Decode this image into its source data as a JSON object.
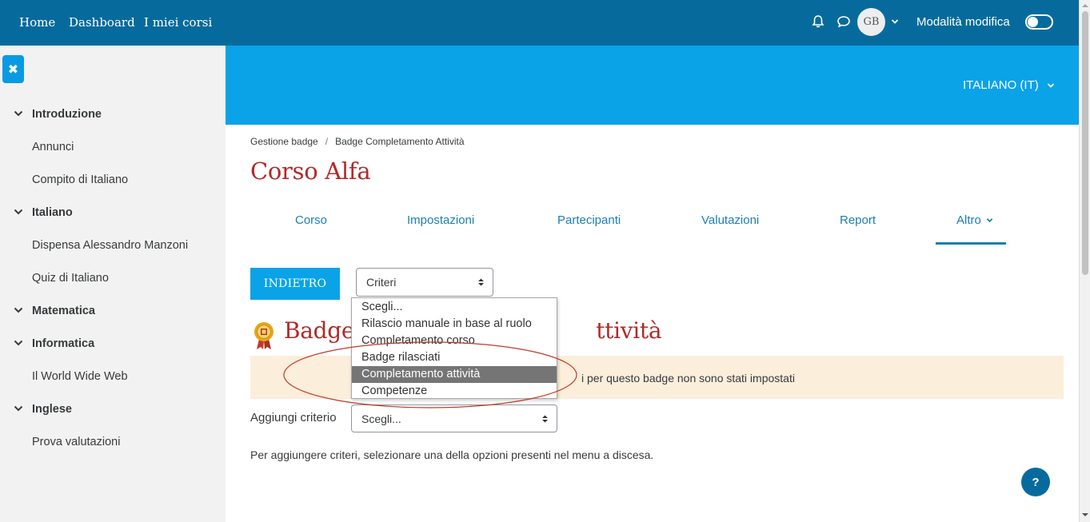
{
  "navbar": {
    "links": [
      "Home",
      "Dashboard",
      "I miei corsi"
    ],
    "avatar_initials": "GB",
    "edit_mode_label": "Modalità modifica",
    "icons": [
      "bell-icon",
      "chat-icon",
      "chevron-down-icon",
      "toggle-switch"
    ]
  },
  "drawer": {
    "close_icon": "close-icon",
    "items": [
      {
        "label": "Introduzione",
        "type": "section"
      },
      {
        "label": "Annunci",
        "type": "child"
      },
      {
        "label": "Compito di Italiano",
        "type": "child"
      },
      {
        "label": "Italiano",
        "type": "section"
      },
      {
        "label": "Dispensa Alessandro Manzoni",
        "type": "child"
      },
      {
        "label": "Quiz di Italiano",
        "type": "child"
      },
      {
        "label": "Matematica",
        "type": "section"
      },
      {
        "label": "Informatica",
        "type": "section"
      },
      {
        "label": "Il World Wide Web",
        "type": "child"
      },
      {
        "label": "Inglese",
        "type": "section"
      },
      {
        "label": "Prova valutazioni",
        "type": "child"
      }
    ]
  },
  "header": {
    "language": "ITALIANO (IT)"
  },
  "breadcrumb": [
    "Gestione badge",
    "Badge Completamento Attività"
  ],
  "course_title": "Corso Alfa",
  "tabs": [
    {
      "label": "Corso"
    },
    {
      "label": "Impostazioni"
    },
    {
      "label": "Partecipanti"
    },
    {
      "label": "Valutazioni"
    },
    {
      "label": "Report"
    },
    {
      "label": "Altro",
      "active": true
    }
  ],
  "toolbar": {
    "back_label": "INDIETRO",
    "criteria_select": "Criteri"
  },
  "badge": {
    "heading_left": "Badge",
    "heading_right": "ttività",
    "alert_text": "i per questo badge non sono stati impostati"
  },
  "add_criterion": {
    "label": "Aggiungi criterio",
    "value": "Scegli...",
    "options": [
      "Scegli...",
      "Rilascio manuale in base al ruolo",
      "Completamento corso",
      "Badge rilasciati",
      "Completamento attività",
      "Competenze"
    ],
    "highlighted_option": "Completamento attività"
  },
  "hint": "Per aggiungere criteri, selezionare una della opzioni presenti nel menu a discesa.",
  "help_label": "?",
  "colors": {
    "navbar": "#066b9c",
    "header_band": "#0aa3e8",
    "title_red": "#b12a2a",
    "link_blue": "#1b7fb3",
    "alert_bg": "#fbeedb",
    "annotation_ellipse": "#c0392b"
  }
}
